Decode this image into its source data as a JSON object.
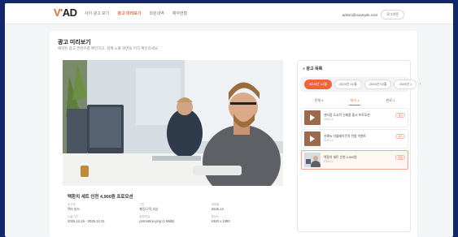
{
  "header": {
    "logo": "V ' AD",
    "nav": [
      "사이 광고 보기",
      "광고 미리보기",
      "회원내역",
      "예약현황"
    ],
    "user_email": "admin@example.com",
    "logout": "로그아웃"
  },
  "page": {
    "title": "광고 미리보기",
    "subtitle": "예약된 광고 콘텐츠를 확인하고, 실제 노출 화면을 미리 확인하세요."
  },
  "preview": {
    "ad_title": "택환치 세트 인천 4,900원 프로모션",
    "meta": [
      {
        "key": "광고명",
        "value": "택드실드"
      },
      {
        "key": "기간",
        "value": "패킷구독 2일"
      },
      {
        "key": "게재월",
        "value": "2025.12"
      },
      {
        "key": "노출기간",
        "value": "2025.12.15 - 2025.12.31"
      },
      {
        "key": "첨부파일",
        "value": "promotion.png (1.8MB)"
      },
      {
        "key": "해상도",
        "value": "1920 x 1080"
      }
    ]
  },
  "panel": {
    "title": "광고 목록",
    "months": [
      "2025년 12월",
      "2025년 01월",
      "2025년 02월",
      "2025년 1"
    ],
    "tabs": [
      "전체 3",
      "대기 1",
      "완료 1"
    ],
    "items": [
      {
        "title": "센터점 도시락 신제품 출시 프로모션",
        "sub": "2025.12",
        "badge": "대기"
      },
      {
        "title": "신메뉴 더블베이컨치 런칭 이벤트",
        "sub": "2025.12",
        "badge": "대기"
      },
      {
        "title": "택환치 세트 인천 4,900원",
        "sub": "2025.12",
        "badge": "완료"
      }
    ]
  },
  "colors": {
    "accent": "#f0643c",
    "frame": "#12286a"
  }
}
